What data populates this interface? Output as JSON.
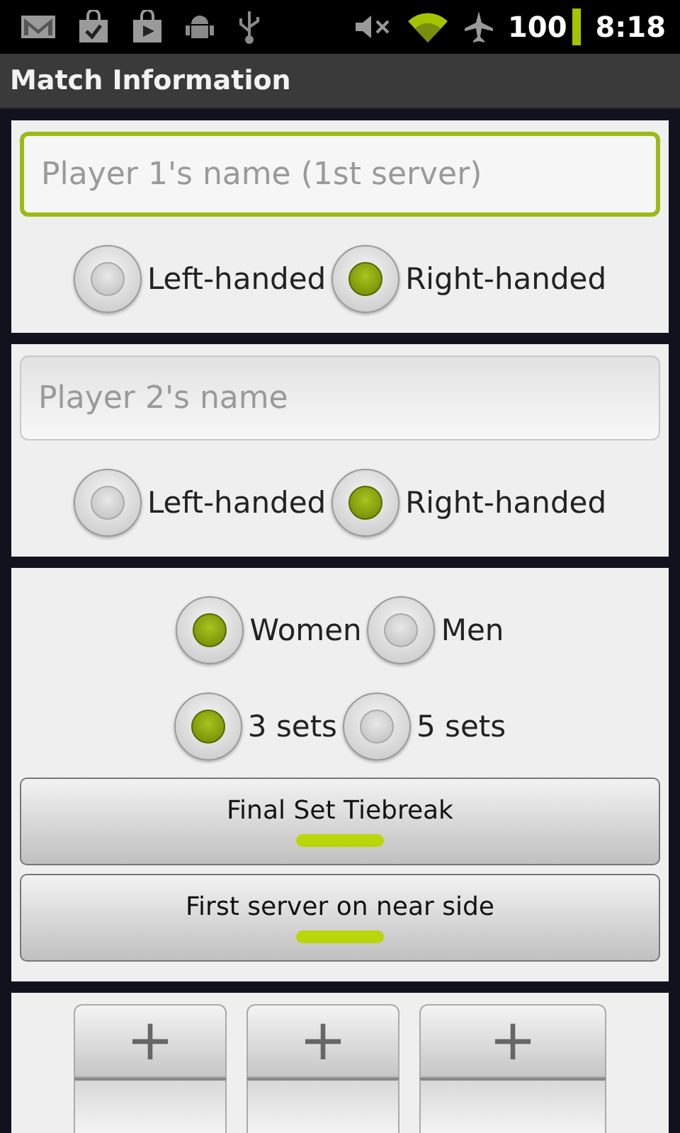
{
  "status_bar": {
    "battery": "100",
    "time": "8:18"
  },
  "title": "Match Information",
  "players": [
    {
      "placeholder": "Player 1's name (1st server)",
      "focused": true,
      "handedness": [
        {
          "label": "Left-handed",
          "selected": false
        },
        {
          "label": "Right-handed",
          "selected": true
        }
      ]
    },
    {
      "placeholder": "Player 2's name",
      "focused": false,
      "handedness": [
        {
          "label": "Left-handed",
          "selected": false
        },
        {
          "label": "Right-handed",
          "selected": true
        }
      ]
    }
  ],
  "options": {
    "radio_groups": [
      [
        {
          "label": "Women",
          "selected": true
        },
        {
          "label": "Men",
          "selected": false
        }
      ],
      [
        {
          "label": "3 sets",
          "selected": true
        },
        {
          "label": "5 sets",
          "selected": false
        }
      ]
    ],
    "toggles": [
      {
        "label": "Final Set Tiebreak",
        "on": true
      },
      {
        "label": "First server on near side",
        "on": true
      }
    ]
  },
  "date_picker": {
    "columns": [
      {
        "increment": "+"
      },
      {
        "increment": "+"
      },
      {
        "increment": "+"
      }
    ]
  }
}
